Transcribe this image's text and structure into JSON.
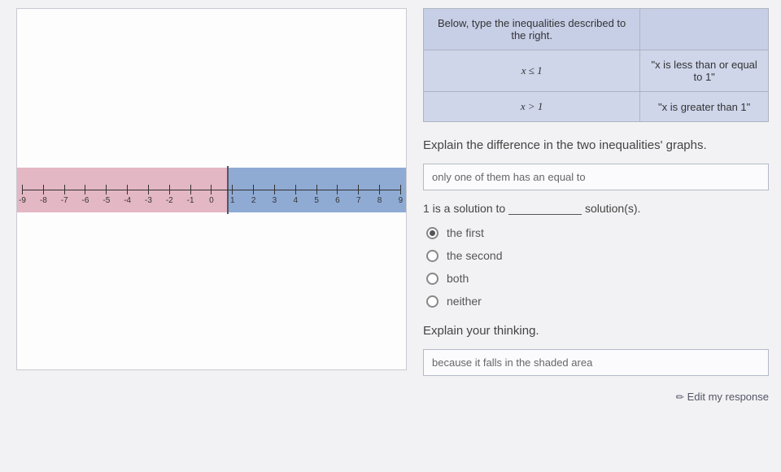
{
  "numberline": {
    "labels": [
      "-9",
      "-8",
      "-7",
      "-6",
      "-5",
      "-4",
      "-3",
      "-2",
      "-1",
      "0",
      "1",
      "2",
      "3",
      "4",
      "5",
      "6",
      "7",
      "8",
      "9"
    ]
  },
  "table": {
    "header": "Below, type the inequalities described to the right.",
    "rows": [
      {
        "ineq": "x ≤ 1",
        "desc": "\"x is less than or equal to 1\""
      },
      {
        "ineq": "x > 1",
        "desc": "\"x is greater than 1\""
      }
    ]
  },
  "prompts": {
    "explain_diff": "Explain the difference in the two inequalities' graphs.",
    "explain_diff_answer": "only one of them has an equal to",
    "fill_prefix": "1 is a solution to ",
    "fill_suffix": " solution(s).",
    "explain_thinking": "Explain your thinking.",
    "explain_thinking_answer": "because it falls in the shaded area"
  },
  "radios": {
    "options": [
      {
        "label": "the first",
        "checked": true
      },
      {
        "label": "the second",
        "checked": false
      },
      {
        "label": "both",
        "checked": false
      },
      {
        "label": "neither",
        "checked": false
      }
    ]
  },
  "footer": {
    "edit_label": "Edit my response"
  }
}
